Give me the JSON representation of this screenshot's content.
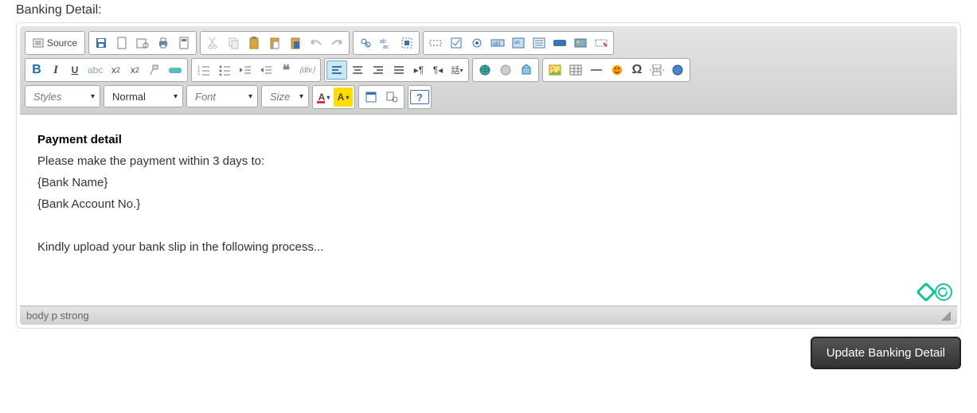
{
  "label": "Banking Detail:",
  "submit_label": "Update Banking Detail",
  "breadcrumb": "body  p  strong",
  "combos": {
    "styles": "Styles",
    "format": "Normal",
    "font": "Font",
    "size": "Size"
  },
  "toolbar": {
    "source": "Source"
  },
  "content": {
    "heading": "Payment detail",
    "line1": "Please make the payment within 3 days to:",
    "line2": "{Bank Name}",
    "line3": "{Bank Account No.}",
    "line4": "Kindly upload your bank slip in the following process..."
  }
}
